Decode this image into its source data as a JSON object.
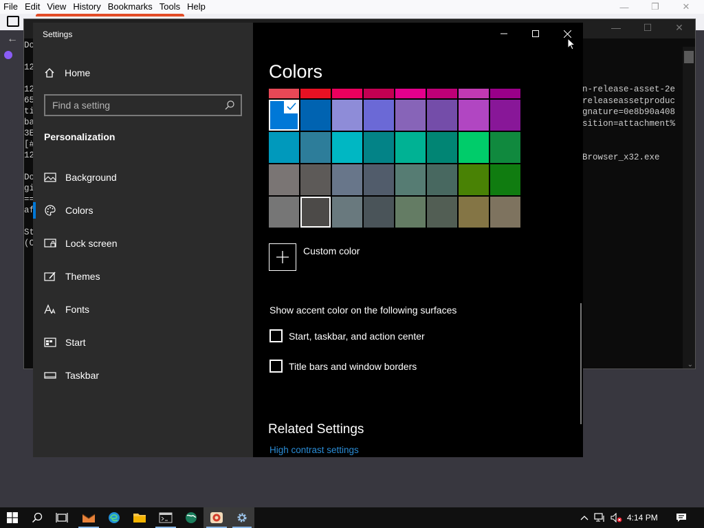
{
  "firefox": {
    "menu": [
      "File",
      "Edit",
      "View",
      "History",
      "Bookmarks",
      "Tools",
      "Help"
    ]
  },
  "console": {
    "left_fragments": [
      "Do",
      "",
      "12",
      "",
      "12",
      "65",
      "ti",
      "ba",
      "3E",
      "[#",
      "12",
      "",
      "Do",
      "gi",
      "==",
      "af",
      "",
      "St",
      "(C"
    ],
    "right_lines": [
      "n-release-asset-2e",
      "releaseassetproduc",
      "gnature=0e8b90a408",
      "sition=attachment%",
      "",
      "",
      "Browser_x32.exe"
    ]
  },
  "settings": {
    "window_title": "Settings",
    "home_label": "Home",
    "search_placeholder": "Find a setting",
    "section_label": "Personalization",
    "nav_items": [
      {
        "label": "Background",
        "icon": "picture-icon"
      },
      {
        "label": "Colors",
        "icon": "palette-icon",
        "active": true
      },
      {
        "label": "Lock screen",
        "icon": "lock-screen-icon"
      },
      {
        "label": "Themes",
        "icon": "themes-icon"
      },
      {
        "label": "Fonts",
        "icon": "fonts-icon"
      },
      {
        "label": "Start",
        "icon": "start-icon"
      },
      {
        "label": "Taskbar",
        "icon": "taskbar-icon"
      }
    ],
    "page_title": "Colors",
    "swatch_top_row": [
      "#e74856",
      "#e81123",
      "#ea005e",
      "#c30052",
      "#e3008c",
      "#bf0077",
      "#c239b3",
      "#9a0089"
    ],
    "swatch_rows": [
      [
        "#0078d7",
        "#0063b1",
        "#8e8cd8",
        "#6b69d6",
        "#8764b8",
        "#744da9",
        "#b146c2",
        "#881798"
      ],
      [
        "#0099bc",
        "#2d7d9a",
        "#00b7c3",
        "#038387",
        "#00b294",
        "#018574",
        "#00cc6a",
        "#10893e"
      ],
      [
        "#7a7574",
        "#5d5a58",
        "#68768a",
        "#515c6b",
        "#567c73",
        "#486860",
        "#498205",
        "#107c10"
      ],
      [
        "#767676",
        "#4c4a48",
        "#69797e",
        "#4a5459",
        "#647c64",
        "#525e54",
        "#847545",
        "#7e735f"
      ]
    ],
    "selected_swatch": "#0078d7",
    "custom_color_label": "Custom color",
    "surfaces_label": "Show accent color on the following surfaces",
    "checkbox_1": "Start, taskbar, and action center",
    "checkbox_2": "Title bars and window borders",
    "related_title": "Related Settings",
    "high_contrast_link": "High contrast settings"
  },
  "taskbar": {
    "time": "4:14 PM"
  }
}
